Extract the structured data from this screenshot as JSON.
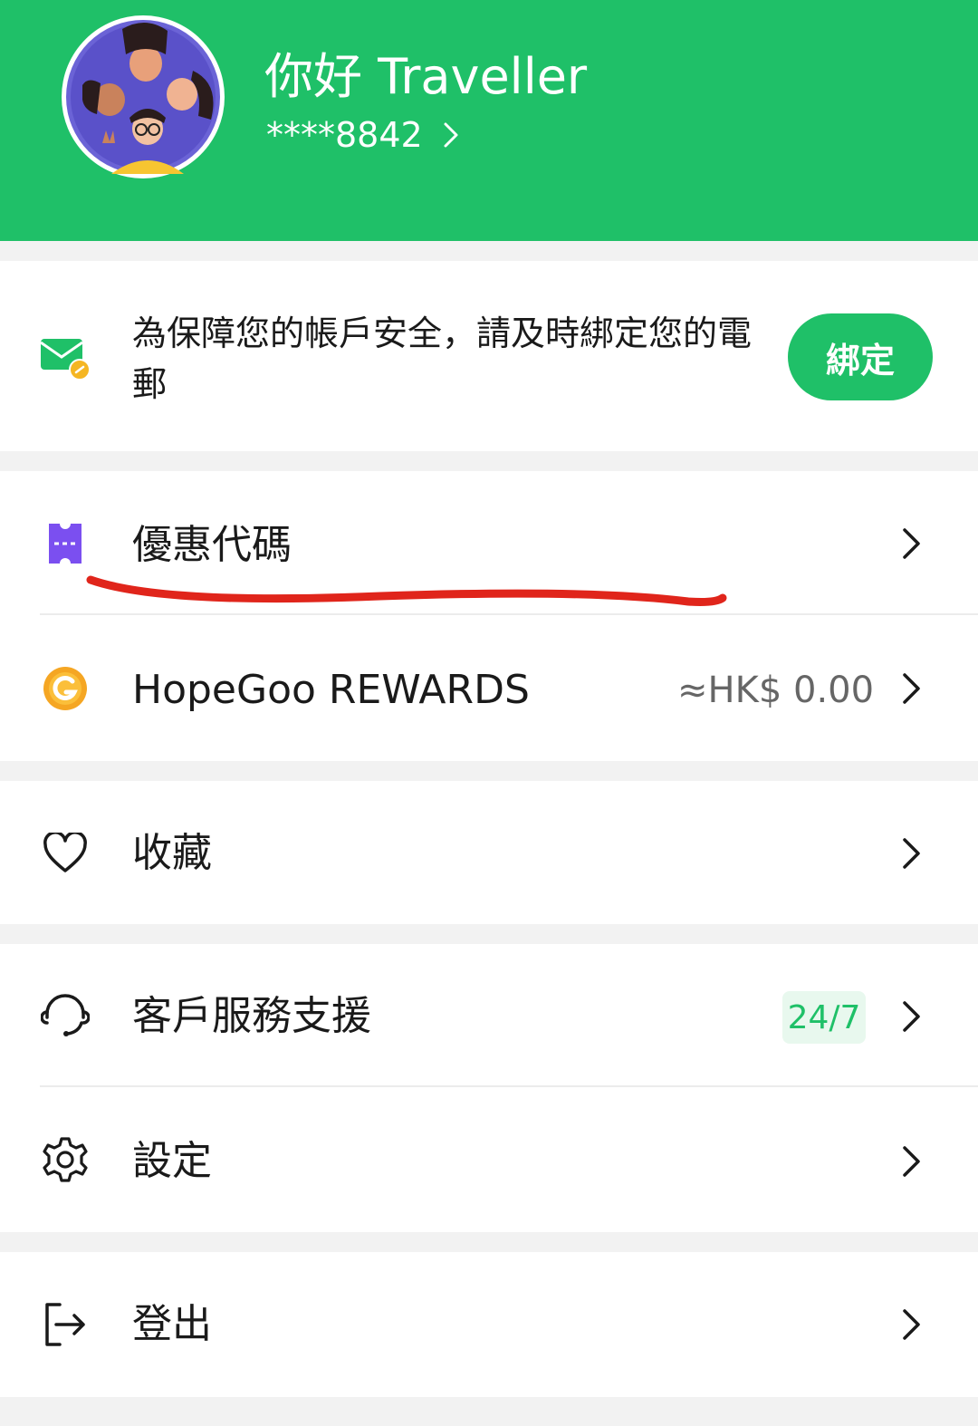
{
  "header": {
    "greeting": "你好 Traveller",
    "account_masked": "****8842",
    "bg_color": "#1fc068"
  },
  "email_prompt": {
    "icon": "email-link-icon",
    "text": "為保障您的帳戶安全，請及時綁定您的電郵",
    "button_label": "綁定"
  },
  "menu": {
    "coupon": {
      "label": "優惠代碼",
      "icon": "ticket-icon"
    },
    "rewards": {
      "label": "HopeGoo REWARDS",
      "value": "≈HK$ 0.00",
      "icon": "coin-icon"
    },
    "favorites": {
      "label": "收藏",
      "icon": "heart-icon"
    },
    "support": {
      "label": "客戶服務支援",
      "badge": "24/7",
      "icon": "headset-icon"
    },
    "settings": {
      "label": "設定",
      "icon": "gear-icon"
    },
    "logout": {
      "label": "登出",
      "icon": "logout-icon"
    }
  },
  "colors": {
    "accent": "#1fc068",
    "coupon_icon": "#7b4ff0",
    "reward_icon": "#f5a623",
    "annotation": "#e0251b"
  }
}
